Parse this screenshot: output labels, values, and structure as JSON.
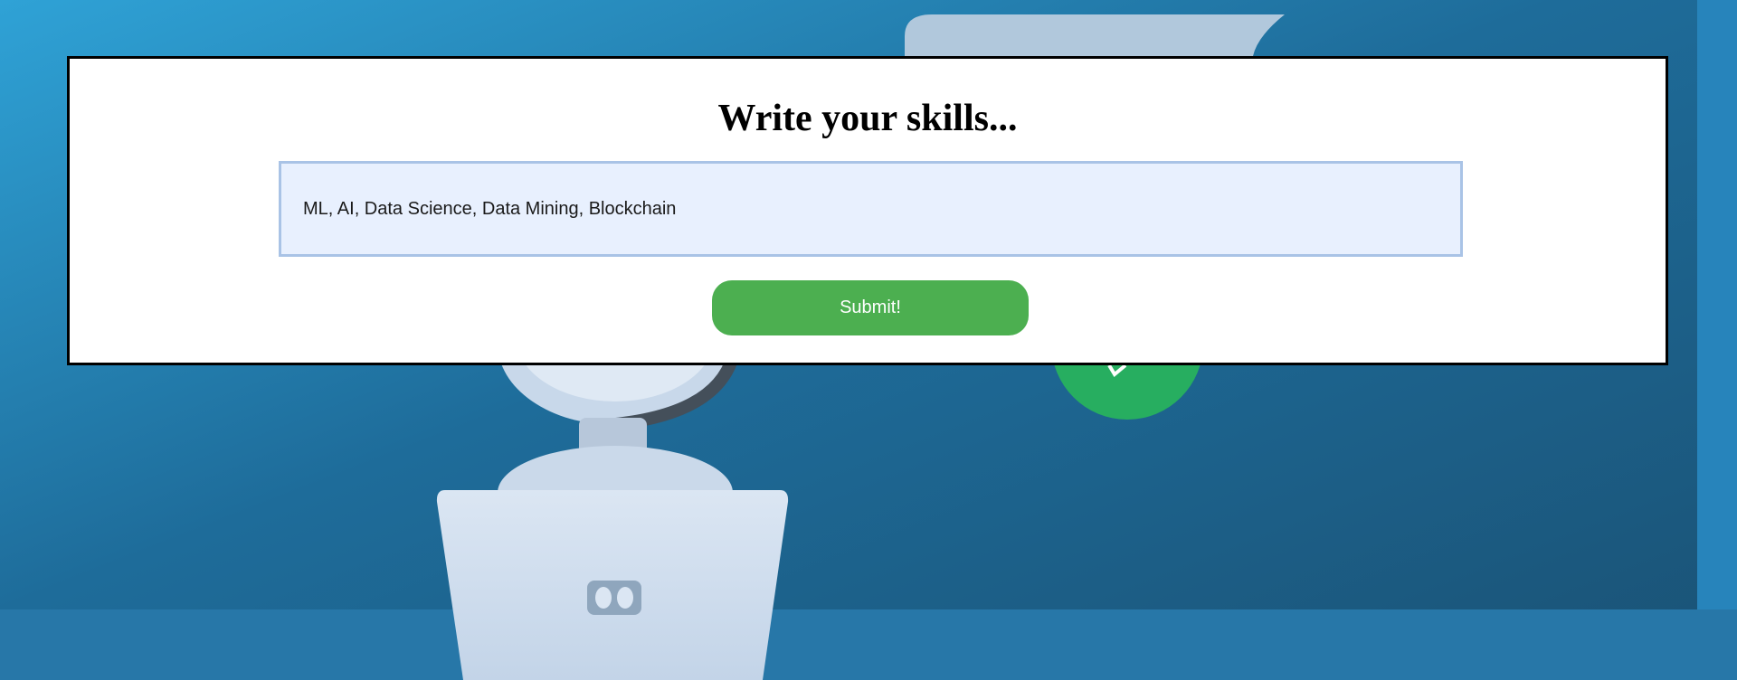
{
  "form": {
    "title": "Write your skills...",
    "skills_value": "ML, AI, Data Science, Data Mining, Blockchain",
    "submit_label": "Submit!"
  },
  "colors": {
    "background": "#1a5275",
    "card": "#ffffff",
    "input_background": "#e8f0fe",
    "submit_button": "#4caf50"
  }
}
